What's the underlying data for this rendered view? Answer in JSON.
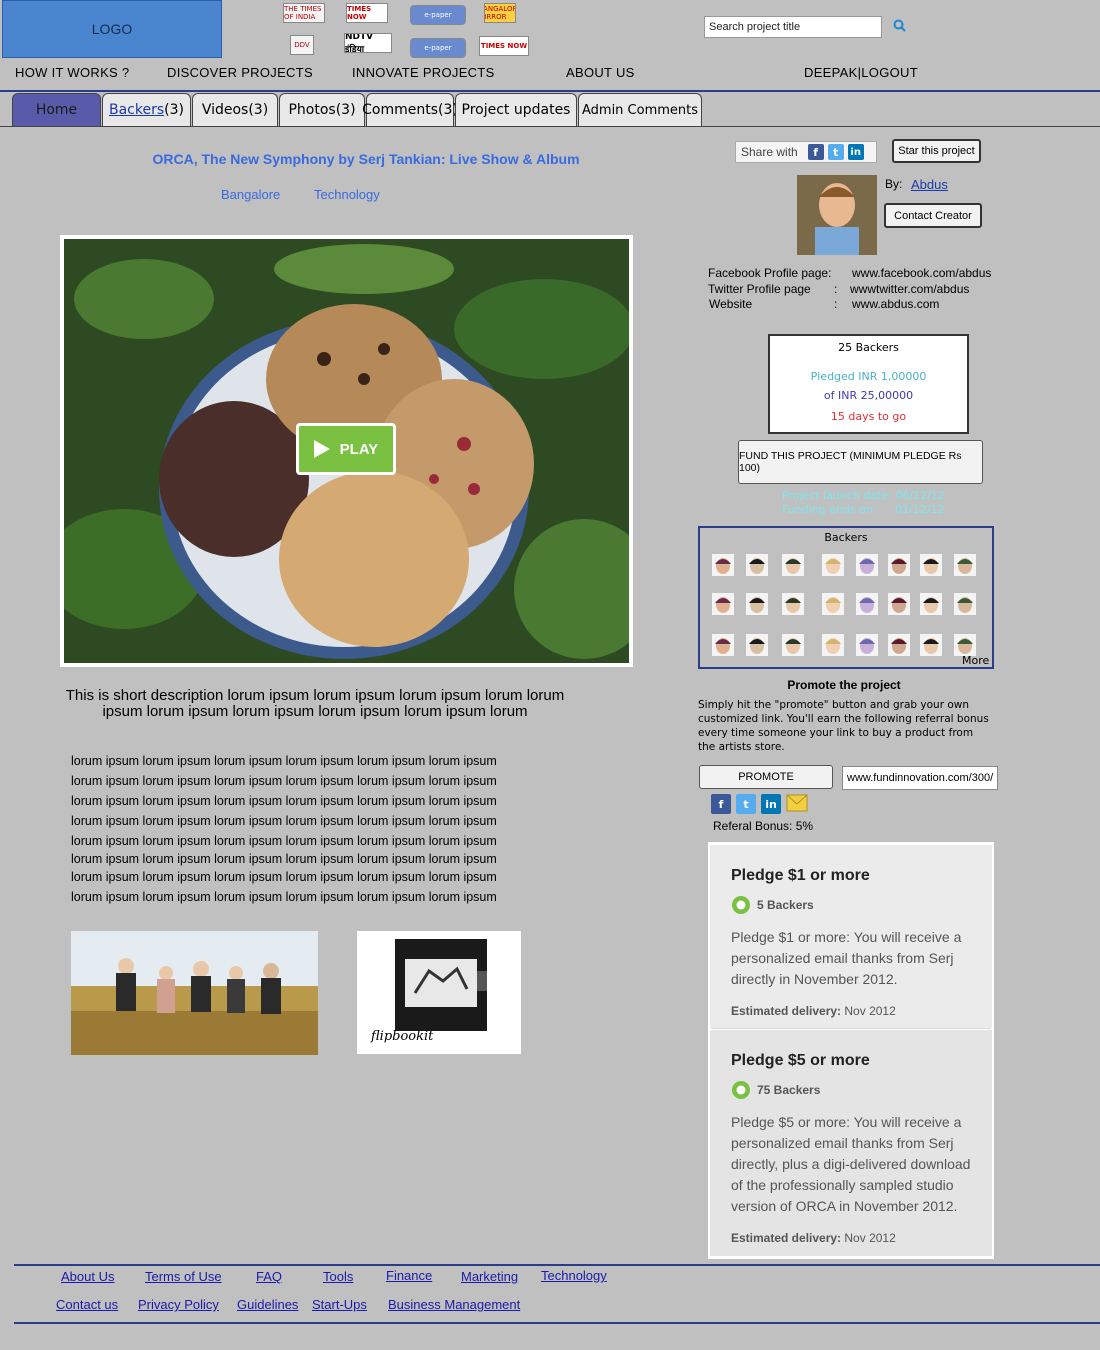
{
  "header": {
    "logo": "LOGO",
    "media_logos": [
      "THE TIMES OF INDIA",
      "TIMES NOW",
      "e-paper",
      "BANGALORE MIRROR",
      "DDV",
      "NDTV इंडिया",
      "e-paper",
      "TIMES NOW"
    ],
    "search_placeholder": "Search project title"
  },
  "nav": {
    "how_it_works": "HOW IT WORKS ?",
    "discover": "DISCOVER PROJECTS",
    "innovate": "INNOVATE PROJECTS",
    "about": "ABOUT US",
    "user": "DEEPAK|LOGOUT"
  },
  "tabs": {
    "home": "Home",
    "backers_label": "Backers",
    "backers_count": "(3)",
    "videos": "Videos(3)",
    "photos": "Photos(3)",
    "comments": "Comments(3)",
    "updates": "Project updates",
    "admin": "Admin Comments"
  },
  "project": {
    "title": "ORCA, The New Symphony by Serj Tankian: Live Show & Album",
    "location": "Bangalore",
    "category": "Technology",
    "play_label": "PLAY",
    "short_desc": "This is short description lorum ipsum lorum ipsum lorum ipsum lorum lorum ipsum lorum ipsum lorum ipsum lorum ipsum lorum ipsum lorum",
    "body_lines": [
      "lorum ipsum lorum ipsum lorum ipsum lorum ipsum lorum ipsum lorum ipsum",
      "lorum ipsum lorum ipsum lorum ipsum lorum ipsum lorum ipsum lorum ipsum",
      "lorum ipsum lorum ipsum lorum ipsum lorum ipsum lorum ipsum lorum ipsum",
      "lorum ipsum lorum ipsum lorum ipsum lorum ipsum lorum ipsum lorum ipsum",
      "lorum ipsum lorum ipsum lorum ipsum lorum ipsum lorum ipsum lorum ipsum",
      "lorum ipsum lorum ipsum lorum ipsum lorum ipsum lorum ipsum lorum ipsum",
      "lorum ipsum lorum ipsum lorum ipsum lorum ipsum lorum ipsum lorum ipsum",
      "lorum ipsum lorum ipsum lorum ipsum lorum ipsum lorum ipsum lorum ipsum"
    ],
    "flipbook_caption": "flipbookit"
  },
  "sidebar": {
    "share_with": "Share with",
    "star_button": "Star this project",
    "by_label": "By:",
    "creator": "Abdus",
    "contact_button": "Contact Creator",
    "fb_label": "Facebook Profile page:",
    "fb_value": "www.facebook.com/abdus",
    "tw_label": "Twitter Profile page",
    "tw_sep": ":",
    "tw_value": "wwwtwitter.com/abdus",
    "web_label": "Website",
    "web_sep": ":",
    "web_value": "www.abdus.com",
    "backers_total": "25 Backers",
    "pledged": "Pledged INR 1,00000",
    "of_goal": "of INR 25,00000",
    "days_to_go": "15 days to go",
    "fund_button": "FUND THIS PROJECT (MINIMUM PLEDGE Rs 100)",
    "launch_date": "Project launch date: 06/12/12",
    "funding_ends_label": "Funding ends on:",
    "funding_ends_date": "01/12/12",
    "backers_grid_title": "Backers",
    "more_label": "More",
    "promote_title": "Promote the project",
    "promote_text": "Simply hit the \"promote\" button and grab your own customized link. You'll earn the following referral bonus every time someone your link to buy a product from the artists store.",
    "promote_button": "PROMOTE",
    "promote_link": "www.fundinnovation.com/300/",
    "referral_bonus": "Referal Bonus: 5%"
  },
  "pledges": [
    {
      "title": "Pledge $1 or more",
      "backers": "5 Backers",
      "desc": "Pledge $1 or more: You will receive a personalized email thanks from Serj directly in November 2012.",
      "est_label": "Estimated delivery:",
      "est_value": "Nov 2012"
    },
    {
      "title": "Pledge $5 or more",
      "backers": "75 Backers",
      "desc": "Pledge $5 or more: You will receive a personalized email thanks from Serj directly, plus a digi-delivered download of the professionally sampled studio version of ORCA in November 2012.",
      "est_label": "Estimated delivery:",
      "est_value": "Nov 2012"
    }
  ],
  "footer": {
    "row1": [
      "About Us",
      "Terms of Use",
      "FAQ",
      "Tools",
      "Finance",
      "Marketing",
      "Technology"
    ],
    "row2": [
      "Contact us",
      "Privacy Policy",
      "Guidelines",
      "Start-Ups",
      "Business Management"
    ]
  },
  "colors": {
    "page_bg": "#c0c0c0",
    "accent_blue": "#3a6ae0",
    "nav_line": "#2b3c8a",
    "logo_blue": "#4a86d0",
    "play_green": "#7ac142"
  }
}
